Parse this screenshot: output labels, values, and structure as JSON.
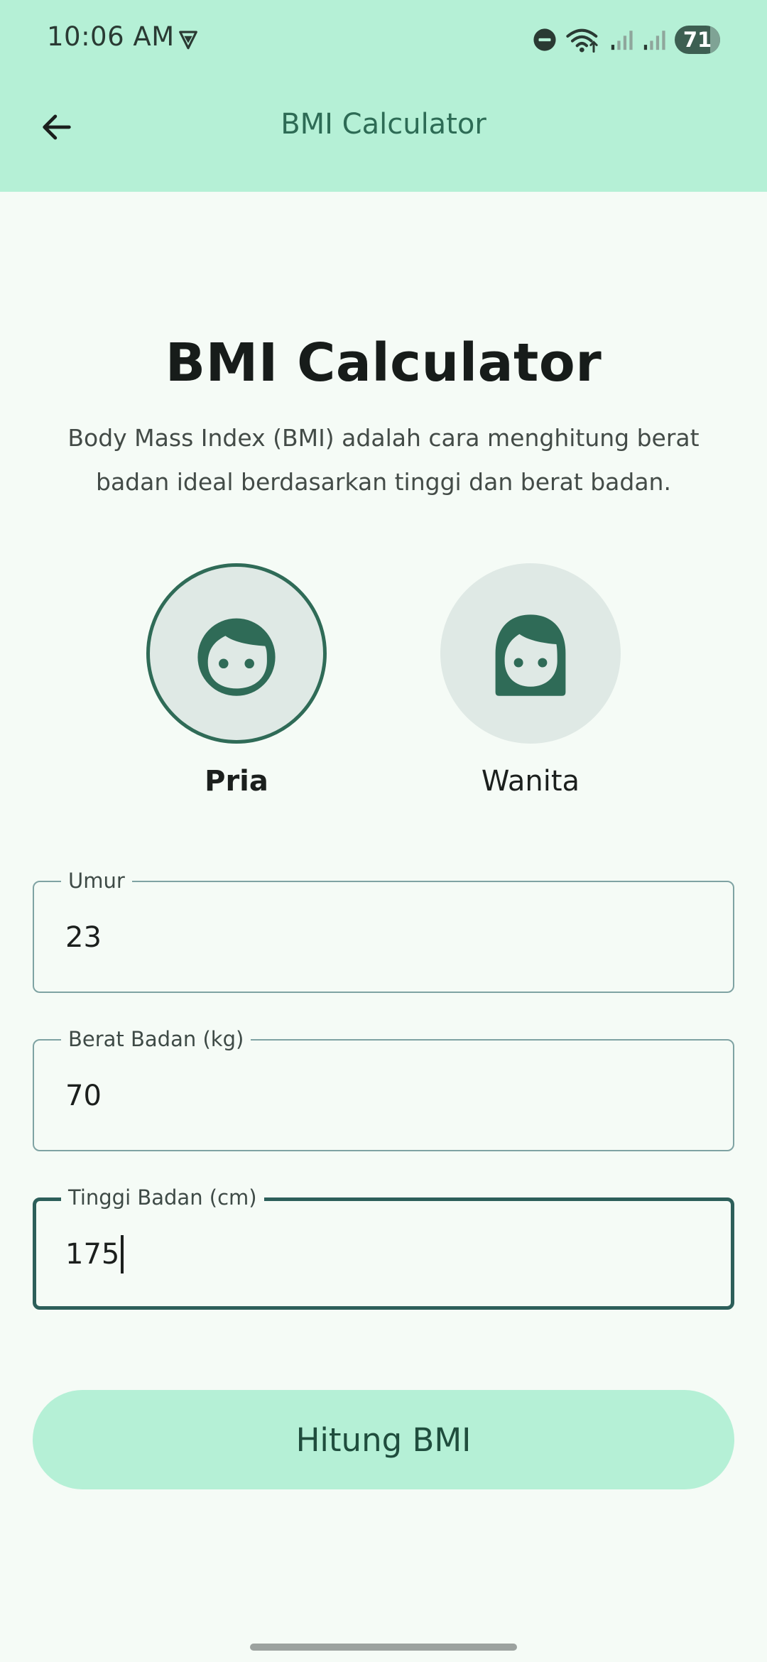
{
  "status_bar": {
    "time": "10:06 AM",
    "battery": "71"
  },
  "app_bar": {
    "title": "BMI Calculator"
  },
  "main": {
    "title": "BMI Calculator",
    "description": "Body Mass Index (BMI) adalah cara menghitung berat badan ideal berdasarkan tinggi dan berat badan.",
    "gender": {
      "selected": "male",
      "male_label": "Pria",
      "female_label": "Wanita"
    },
    "fields": {
      "age": {
        "label": "Umur",
        "value": "23"
      },
      "weight": {
        "label": "Berat Badan (kg)",
        "value": "70"
      },
      "height": {
        "label": "Tinggi Badan (cm)",
        "value": "175"
      }
    },
    "calculate_label": "Hitung BMI"
  },
  "colors": {
    "header_bg": "#b5f0d6",
    "page_bg": "#f5fbf6",
    "accent": "#2f6b57",
    "button_bg": "#b5f0d6"
  }
}
